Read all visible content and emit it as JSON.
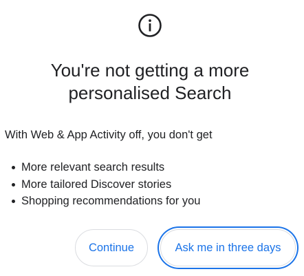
{
  "dialog": {
    "icon": "info-circle-icon",
    "title": "You're not getting a more personalised Search",
    "intro": "With Web & App Activity off, you don't get",
    "bullets": [
      "More relevant search results",
      "More tailored Discover stories",
      "Shopping recommendations for you"
    ],
    "buttons": {
      "continue_label": "Continue",
      "ask_later_label": "Ask me in three days"
    }
  },
  "colors": {
    "text": "#202124",
    "accent": "#1a73e8",
    "button_border": "#dadce0",
    "background": "#ffffff"
  }
}
